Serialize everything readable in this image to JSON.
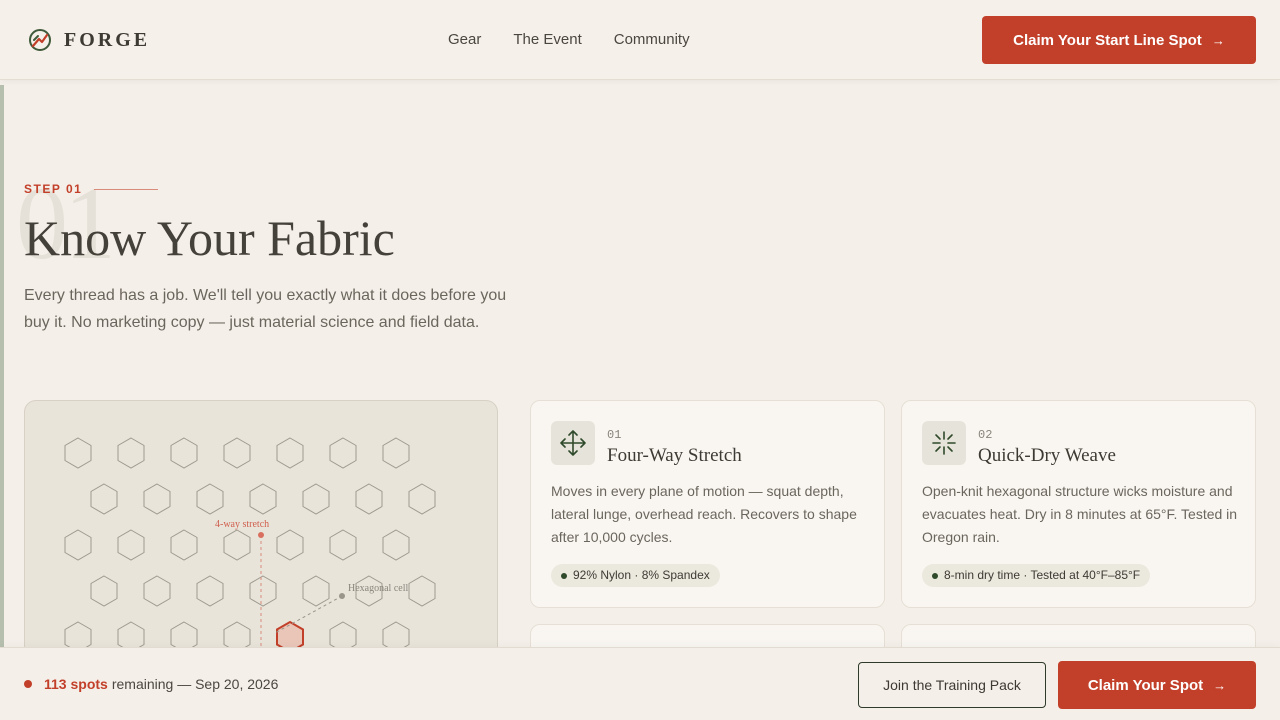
{
  "brand": {
    "name": "FORGE",
    "accent": "#c2402a",
    "icon": "forge-logo-icon"
  },
  "nav": {
    "items": [
      "Gear",
      "The Event",
      "Community"
    ]
  },
  "header_cta": {
    "label": "Claim Your Start Line Spot",
    "icon": "arrow-right-icon"
  },
  "hero": {
    "step_label": "STEP 01",
    "big_number": "01",
    "title": "Know Your Fabric",
    "subtitle": "Every thread has a job. We'll tell you exactly what it does before you buy it. No marketing copy — just material science and field data."
  },
  "fabric_diagram": {
    "labels": {
      "stretch": "4-way stretch",
      "cell": "Hexagonal cell"
    }
  },
  "cards": [
    {
      "number": "01",
      "title": "Four-Way Stretch",
      "icon": "move-arrows-icon",
      "body": "Moves in every plane of motion — squat depth, lateral lunge, overhead reach. Recovers to shape after 10,000 cycles.",
      "tag": "92% Nylon · 8% Spandex"
    },
    {
      "number": "02",
      "title": "Quick-Dry Weave",
      "icon": "burst-icon",
      "body": "Open-knit hexagonal structure wicks moisture and evacuates heat. Dry in 8 minutes at 65°F. Tested in Oregon rain.",
      "tag": "8-min dry time · Tested at 40°F–85°F"
    }
  ],
  "bottom_bar": {
    "spots_count": "113 spots",
    "spots_text": "remaining — Sep 20, 2026",
    "secondary_label": "Join the Training Pack",
    "primary_label": "Claim Your Spot"
  }
}
